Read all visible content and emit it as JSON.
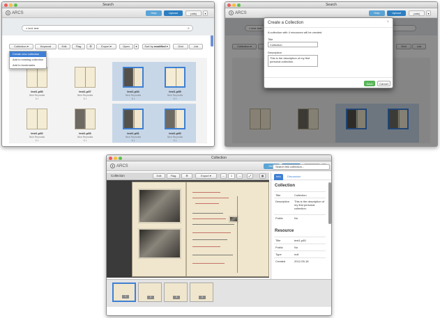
{
  "window1": {
    "title": "Search",
    "header": {
      "logo": "ARCS",
      "help": "Help",
      "upload": "Upload",
      "user": "paisj"
    },
    "search": {
      "query": "text: test",
      "clear": "⊗"
    },
    "toolbar": {
      "collection": "Collection",
      "keyword": "Keyword",
      "edit": "Edit",
      "flag": "Flag",
      "gear": "⚙",
      "export": "Export",
      "open": "Open",
      "sort": "Sort by",
      "sort_value": "modified",
      "grid": "Grid",
      "list": "List"
    },
    "dropdown": [
      "Create new collection",
      "Add to existing collection",
      "Add to bookmarks"
    ],
    "cards": [
      {
        "title": "test1-p86",
        "sub": "Nick Reynolds",
        "count": "1"
      },
      {
        "title": "test1-p87",
        "sub": "Nick Reynolds",
        "count": "1"
      },
      {
        "title": "test1-p84",
        "sub": "Nick Reynolds",
        "count": "1"
      },
      {
        "title": "test1-p85",
        "sub": "Nick Reynolds",
        "count": "1"
      },
      {
        "title": "test1-p82",
        "sub": "Nick Reynolds",
        "count": "1"
      },
      {
        "title": "test1-p83",
        "sub": "Nick Reynolds",
        "count": "1"
      },
      {
        "title": "test1-p81",
        "sub": "Nick Reynolds",
        "count": "1"
      },
      {
        "title": "test1-p80",
        "sub": "Nick Reynolds",
        "count": "1"
      }
    ]
  },
  "window2": {
    "title": "Search",
    "modal": {
      "title": "Create a Collection",
      "close": "×",
      "description": "A collection with 4 resources will be created.",
      "title_label": "Title",
      "title_value": "Collection",
      "desc_label": "Description",
      "desc_value": "This is the description of my first personal collection.",
      "save": "Save",
      "cancel": "Cancel"
    }
  },
  "window3": {
    "title": "Collection",
    "viewer_label": "Collection",
    "toolbar": {
      "edit": "Edit",
      "flag": "Flag",
      "gear": "⚙",
      "export": "Export",
      "prev": "←",
      "page": "1",
      "next": "→",
      "expand": "⤢",
      "grid": "▦"
    },
    "search_placeholder": "Search this collection...",
    "tabs": {
      "info": "Info",
      "discussion": "Discussion"
    },
    "collection_heading": "Collection",
    "collection_rows": [
      {
        "k": "Title",
        "v": "Collection"
      },
      {
        "k": "Description",
        "v": "This is the description of my first personal collection."
      },
      {
        "k": "Public",
        "v": "No"
      }
    ],
    "resource_heading": "Resource",
    "resource_rows": [
      {
        "k": "Title",
        "v": "test1-p80"
      },
      {
        "k": "Public",
        "v": "No"
      },
      {
        "k": "Type",
        "v": "null"
      },
      {
        "k": "Created",
        "v": "2012-05-18"
      }
    ],
    "thumbs": [
      "1",
      "2",
      "3",
      "4"
    ]
  }
}
